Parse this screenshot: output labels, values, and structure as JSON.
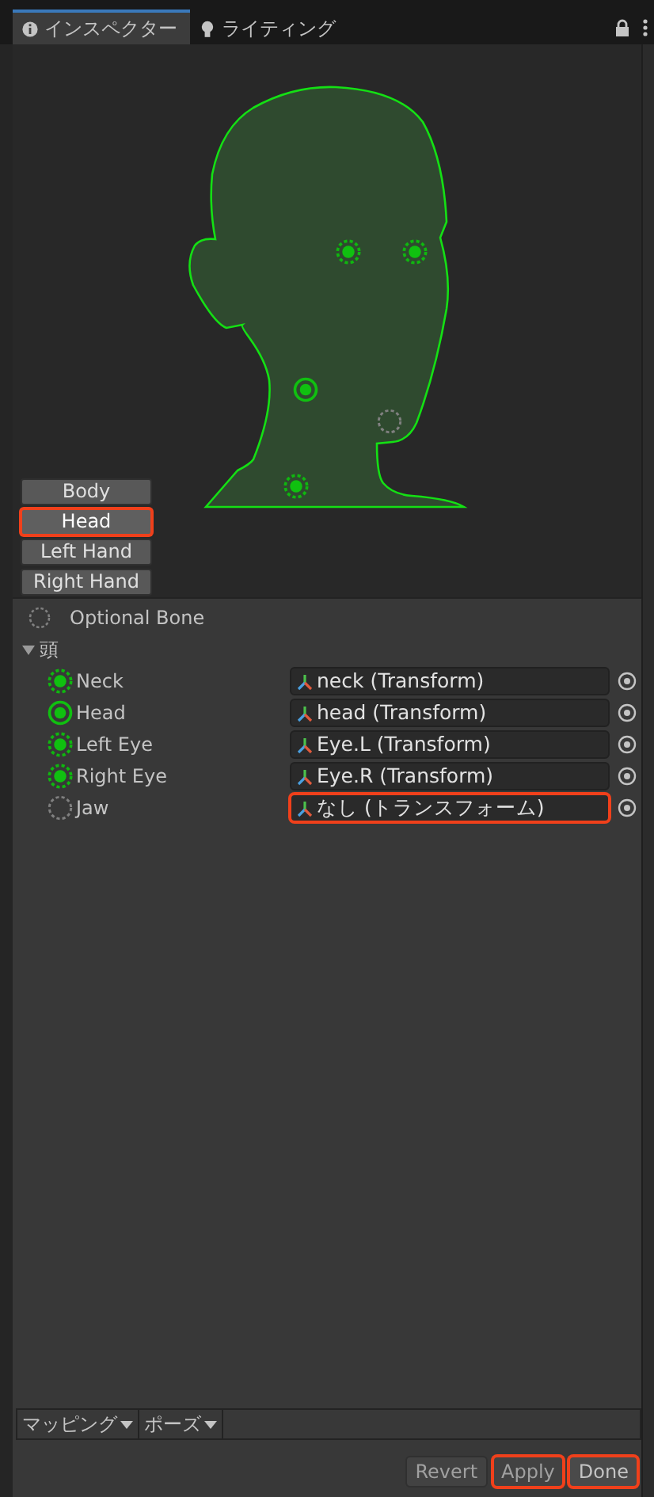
{
  "tabs": [
    {
      "label": "インスペクター",
      "selected": true
    },
    {
      "label": "ライティング",
      "selected": false
    }
  ],
  "body_parts": [
    {
      "label": "Body",
      "selected": false,
      "highlighted": false
    },
    {
      "label": "Head",
      "selected": true,
      "highlighted": true
    },
    {
      "label": "Left Hand",
      "selected": false,
      "highlighted": false
    },
    {
      "label": "Right Hand",
      "selected": false,
      "highlighted": false
    }
  ],
  "legend": {
    "label": "Optional Bone"
  },
  "group": {
    "label": "頭",
    "expanded": true
  },
  "bones": [
    {
      "name": "Neck",
      "kind": "mapped",
      "value": "neck (Transform)",
      "highlighted": false
    },
    {
      "name": "Head",
      "kind": "active",
      "value": "head (Transform)",
      "highlighted": false
    },
    {
      "name": "Left Eye",
      "kind": "mapped",
      "value": "Eye.L (Transform)",
      "highlighted": false
    },
    {
      "name": "Right Eye",
      "kind": "mapped",
      "value": "Eye.R (Transform)",
      "highlighted": false
    },
    {
      "name": "Jaw",
      "kind": "optional",
      "value": "なし (トランスフォーム)",
      "highlighted": true
    }
  ],
  "menus": [
    {
      "label": "マッピング"
    },
    {
      "label": "ポーズ"
    }
  ],
  "buttons": [
    {
      "label": "Revert",
      "disabled": true,
      "highlighted": false
    },
    {
      "label": "Apply",
      "disabled": true,
      "highlighted": true
    },
    {
      "label": "Done",
      "disabled": false,
      "highlighted": true
    }
  ]
}
